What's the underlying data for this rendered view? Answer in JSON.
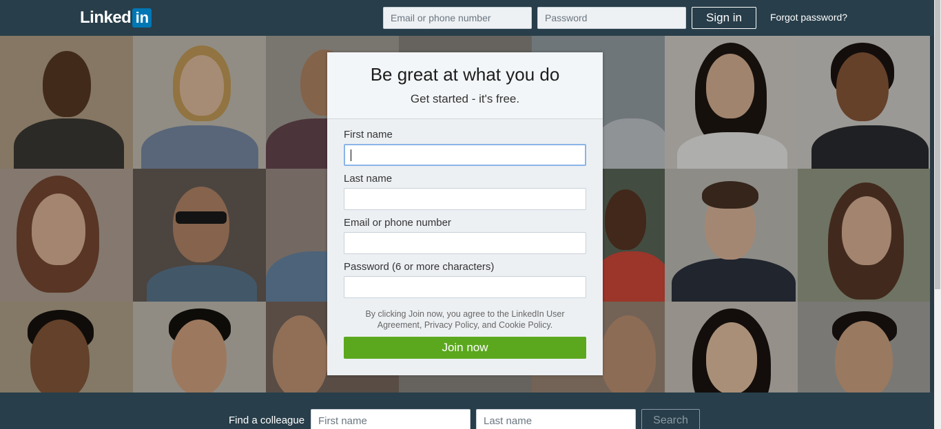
{
  "header": {
    "logo_text": "Linked",
    "logo_in": "in",
    "email_placeholder": "Email or phone number",
    "password_placeholder": "Password",
    "signin_label": "Sign in",
    "forgot_label": "Forgot password?"
  },
  "join": {
    "title": "Be great at what you do",
    "subtitle": "Get started - it's free.",
    "first_name_label": "First name",
    "last_name_label": "Last name",
    "email_label": "Email or phone number",
    "password_label": "Password (6 or more characters)",
    "agreement": "By clicking Join now, you agree to the LinkedIn User Agreement, Privacy Policy, and Cookie Policy.",
    "join_label": "Join now"
  },
  "find": {
    "label": "Find a colleague",
    "first_placeholder": "First name",
    "last_placeholder": "Last name",
    "search_label": "Search"
  },
  "colors": {
    "header_bg": "#283e4a",
    "brand_blue": "#0077b5",
    "join_green": "#5ba81e"
  }
}
